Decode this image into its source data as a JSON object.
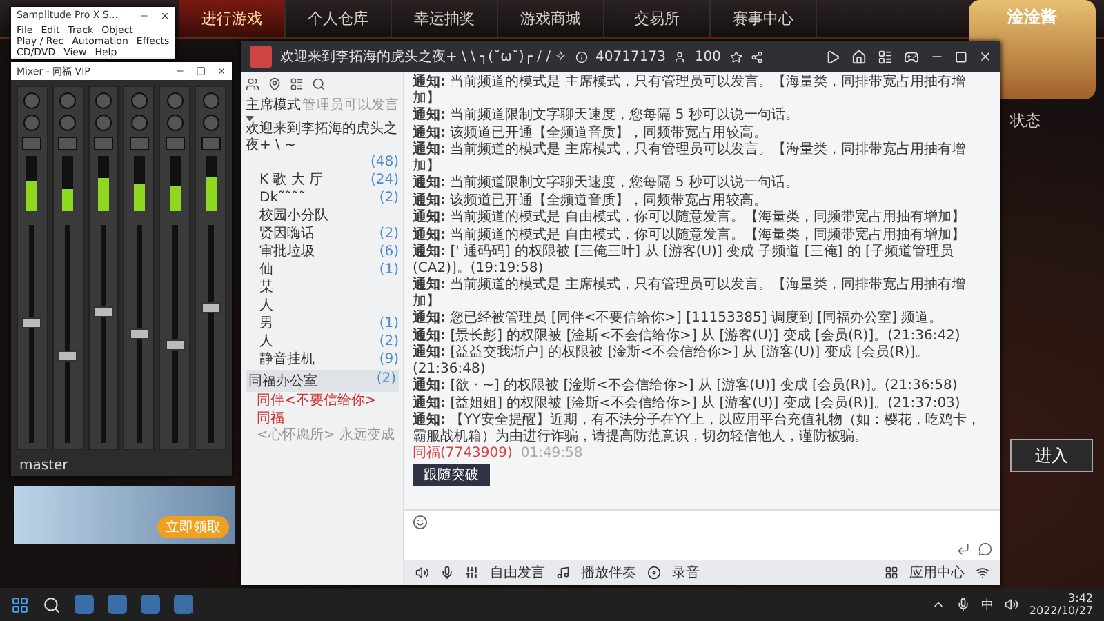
{
  "launcher": {
    "tabs": [
      {
        "label": "进行游戏",
        "selected": true
      },
      {
        "label": "个人仓库",
        "selected": false
      },
      {
        "label": "幸运抽奖",
        "selected": false
      },
      {
        "label": "游戏商城",
        "selected": false
      },
      {
        "label": "交易所",
        "selected": false
      },
      {
        "label": "赛事中心",
        "selected": false
      }
    ],
    "mascot_name": "淦淦酱",
    "status_label": "状态",
    "enter_button": "进入",
    "ad_button": "立即领取"
  },
  "samplitude": {
    "title": "Samplitude Pro X S...",
    "menus": [
      "File",
      "Edit",
      "Track",
      "Object",
      "Play / Rec",
      "Automation",
      "Effects",
      "CD/DVD",
      "View",
      "Help"
    ]
  },
  "mixer": {
    "title": "Mixer - 同福 VIP",
    "master_label": "master",
    "channels": [
      {
        "level": 0.55
      },
      {
        "level": 0.4
      },
      {
        "level": 0.6
      },
      {
        "level": 0.5
      },
      {
        "level": 0.45
      },
      {
        "level": 0.62
      }
    ]
  },
  "yy": {
    "title": "欢迎来到李拓海的虎头之夜+ \\ \\ ┐(˘ω˘)┌ / / ✧",
    "channel_id": "40717173",
    "online": "100",
    "mode": "主席模式",
    "mode_note": "管理员可以发言",
    "tree": [
      {
        "name": "欢迎来到李拓海的虎头之夜+ \\ ~",
        "count": "(48)",
        "expanded": true,
        "children": [
          {
            "name": "K 歌 大 厅",
            "count": "(24)"
          },
          {
            "name": "Dk˜˜˜˜",
            "count": "(2)"
          },
          {
            "name": "校园小分队"
          },
          {
            "name": "贤因嗨话",
            "count": "(2)"
          },
          {
            "name": "审批垃圾",
            "count": "(6)"
          },
          {
            "name": "仙",
            "count": "(1)"
          },
          {
            "name": "某"
          },
          {
            "name": "人"
          },
          {
            "name": "男",
            "count": "(1)"
          },
          {
            "name": "人",
            "count": "(2)"
          },
          {
            "name": "静音挂机",
            "count": "(9)"
          }
        ]
      }
    ],
    "office": {
      "name": "同福办公室",
      "count": "(2)",
      "users": [
        {
          "name": "同伴<不要信给你>"
        },
        {
          "name": "同福",
          "note": "<心怀愿所> 永远变成"
        }
      ]
    },
    "messages": [
      {
        "prefix": "通知:",
        "text": "当前频道的模式是 主席模式，只有管理员可以发言。【海量类，同排带宽占用抽有增加】"
      },
      {
        "prefix": "通知:",
        "text": "当前频道限制文字聊天速度，您每隔 5 秒可以说一句话。"
      },
      {
        "prefix": "通知:",
        "text": "该频道已开通【全频道音质】，同频带宽占用较高。"
      },
      {
        "prefix": "通知:",
        "text": "当前频道的模式是 主席模式，只有管理员可以发言。【海量类，同排带宽占用抽有增加】"
      },
      {
        "prefix": "通知:",
        "text": "当前频道限制文字聊天速度，您每隔 5 秒可以说一句话。"
      },
      {
        "prefix": "通知:",
        "text": "该频道已开通【全频道音质】，同频带宽占用较高。"
      },
      {
        "prefix": "通知:",
        "text": "当前频道的模式是 自由模式，你可以随意发言。【海量类，同频带宽占用抽有增加】"
      },
      {
        "prefix": "通知:",
        "text": "当前频道的模式是 自由模式，你可以随意发言。【海量类，同频带宽占用抽有增加】"
      },
      {
        "prefix": "通知:",
        "text": "[' 通码码] 的权限被 [三俺三叶] 从 [游客(U)] 变成 子频道 [三俺] 的 [子频道管理员(CA2)]。(19:19:58)"
      },
      {
        "prefix": "通知:",
        "text": "当前频道的模式是 主席模式，只有管理员可以发言。【海量类，同排带宽占用抽有增加】"
      },
      {
        "prefix": "通知:",
        "text": "您已经被管理员 [同伴<不要信给你>] [11153385] 调度到 [同福办公室] 频道。"
      },
      {
        "prefix": "通知:",
        "text": "[景长彭] 的权限被 [淦斯<不会信给你>] 从 [游客(U)] 变成 [会员(R)]。(21:36:42)"
      },
      {
        "prefix": "通知:",
        "text": "[益益交我渐户] 的权限被 [淦斯<不会信给你>] 从 [游客(U)] 变成 [会员(R)]。(21:36:48)"
      },
      {
        "prefix": "通知:",
        "text": "[欲 · ~] 的权限被 [淦斯<不会信给你>] 从 [游客(U)] 变成 [会员(R)]。(21:36:58)"
      },
      {
        "prefix": "通知:",
        "text": "[益姐姐] 的权限被 [淦斯<不会信给你>] 从 [游客(U)] 变成 [会员(R)]。(21:37:03)"
      },
      {
        "prefix": "通知:",
        "text": "【YY安全提醒】近期，有不法分子在YY上，以应用平台充值礼物（如：樱花，吃鸡卡，霸服战机箱）为由进行诈骗，请提高防范意识，切勿轻信他人，谨防被骗。"
      }
    ],
    "sender": {
      "name": "同福(7743909)",
      "time": "01:49:58"
    },
    "card_button": "跟随突破",
    "toolbar": [
      "自由发言",
      "播放伴奏",
      "录音"
    ],
    "app_center": "应用中心"
  },
  "taskbar": {
    "ime": "中",
    "time": "3:42",
    "date": "2022/10/27"
  }
}
